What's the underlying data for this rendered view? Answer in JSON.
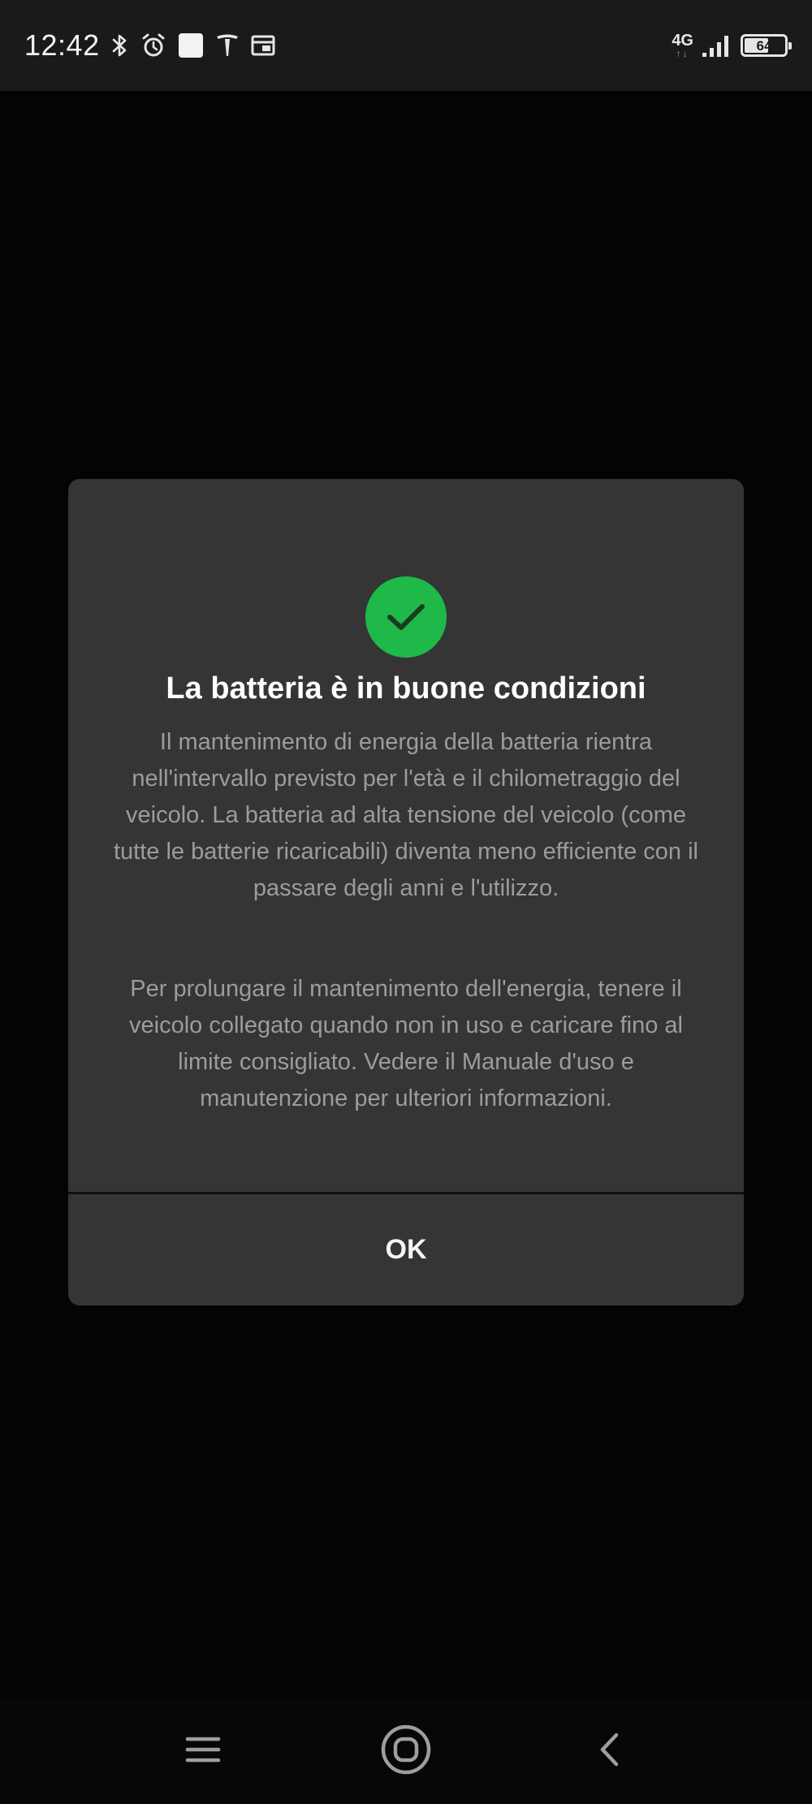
{
  "status_bar": {
    "time": "12:42",
    "network": "4G",
    "network_arrows": "↑↓",
    "battery_level": "64",
    "battery_fraction": 0.64,
    "icons": [
      "bluetooth-icon",
      "alarm-icon",
      "notification-square-icon",
      "tesla-icon",
      "cast-icon",
      "signal-icon",
      "battery-icon"
    ]
  },
  "dialog": {
    "icon": "check-circle-icon",
    "accent_color": "#1fb94a",
    "title": "La batteria è in buone condizioni",
    "paragraph_1": "Il mantenimento di energia della batteria rientra nell'intervallo previsto per l'età e il chilometraggio del veicolo. La batteria ad alta tensione del veicolo (come tutte le batterie ricaricabili) diventa meno efficiente con il passare degli anni e l'utilizzo.",
    "paragraph_2": "Per prolungare il mantenimento dell'energia, tenere il veicolo collegato quando non in uso e caricare fino al limite consigliato. Vedere il Manuale d'uso e manutenzione per ulteriori informazioni.",
    "ok_label": "OK"
  },
  "nav_bar": {
    "icons": [
      "menu-icon",
      "home-icon",
      "back-icon"
    ]
  }
}
